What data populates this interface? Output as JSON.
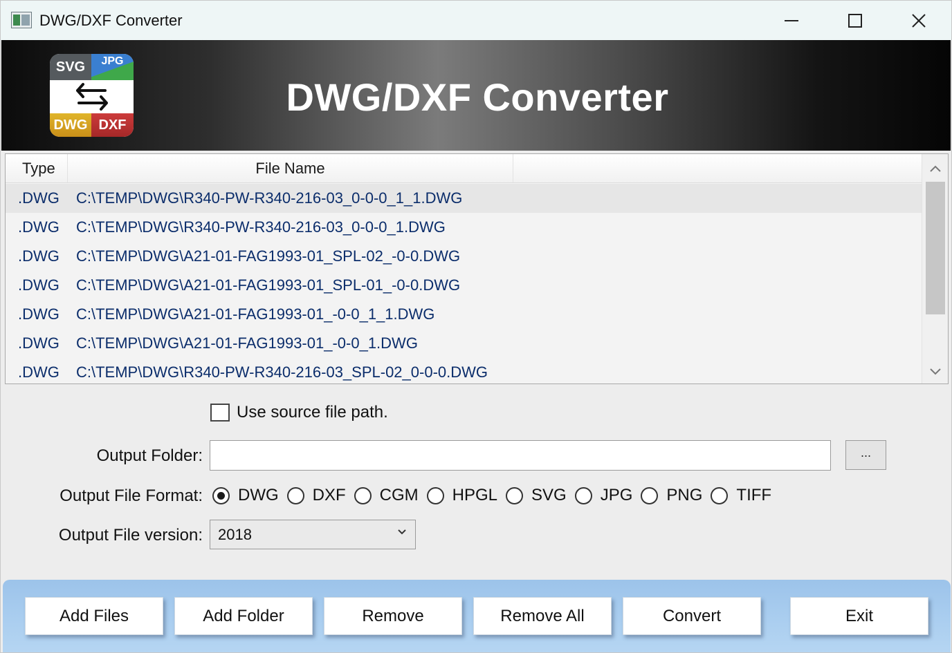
{
  "window": {
    "title": "DWG/DXF Converter"
  },
  "banner": {
    "title": "DWG/DXF Converter",
    "logo": {
      "top_left": "SVG",
      "top_right": "JPG",
      "bottom_left": "DWG",
      "bottom_right": "DXF"
    }
  },
  "file_list": {
    "columns": [
      "Type",
      "File Name"
    ],
    "rows": [
      {
        "type": ".DWG",
        "file": "C:\\TEMP\\DWG\\R340-PW-R340-216-03_0-0-0_1_1.DWG"
      },
      {
        "type": ".DWG",
        "file": "C:\\TEMP\\DWG\\R340-PW-R340-216-03_0-0-0_1.DWG"
      },
      {
        "type": ".DWG",
        "file": "C:\\TEMP\\DWG\\A21-01-FAG1993-01_SPL-02_-0-0.DWG"
      },
      {
        "type": ".DWG",
        "file": "C:\\TEMP\\DWG\\A21-01-FAG1993-01_SPL-01_-0-0.DWG"
      },
      {
        "type": ".DWG",
        "file": "C:\\TEMP\\DWG\\A21-01-FAG1993-01_-0-0_1_1.DWG"
      },
      {
        "type": ".DWG",
        "file": "C:\\TEMP\\DWG\\A21-01-FAG1993-01_-0-0_1.DWG"
      },
      {
        "type": ".DWG",
        "file": "C:\\TEMP\\DWG\\R340-PW-R340-216-03_SPL-02_0-0-0.DWG"
      }
    ]
  },
  "options": {
    "use_source_path_label": "Use source file path.",
    "use_source_path_checked": false,
    "output_folder_label": "Output Folder:",
    "output_folder_value": "",
    "browse_label": "...",
    "format_label": "Output File Format:",
    "formats": [
      "DWG",
      "DXF",
      "CGM",
      "HPGL",
      "SVG",
      "JPG",
      "PNG",
      "TIFF"
    ],
    "selected_format": "DWG",
    "version_label": "Output File version:",
    "version_value": "2018"
  },
  "buttons": {
    "add_files": "Add Files",
    "add_folder": "Add Folder",
    "remove": "Remove",
    "remove_all": "Remove All",
    "convert": "Convert",
    "exit": "Exit"
  },
  "icons": {
    "minimize": "minimize-icon",
    "maximize": "maximize-icon",
    "close": "close-icon",
    "swap": "swap-arrows-icon",
    "scroll_up": "chevron-up-icon",
    "scroll_down": "chevron-down-icon",
    "dropdown": "chevron-down-icon"
  },
  "colors": {
    "banner_text": "#ffffff",
    "list_text": "#0b2d6b",
    "bottom_bar": "#a9cdef"
  }
}
